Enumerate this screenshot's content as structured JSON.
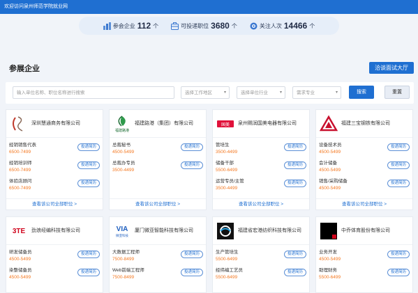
{
  "topbar": {
    "text": "欢迎访问泉州师范学院就业网"
  },
  "stats": [
    {
      "label": "参会企业",
      "value": "112",
      "unit": "个",
      "icon": "buildings-icon"
    },
    {
      "label": "可投递职位",
      "value": "3680",
      "unit": "个",
      "icon": "briefcase-icon"
    },
    {
      "label": "关注人次",
      "value": "14466",
      "unit": "个",
      "icon": "eye-icon"
    }
  ],
  "section": {
    "title": "参展企业",
    "hall_button": "洽谈面试大厅"
  },
  "filter": {
    "keyword_placeholder": "输入单位名称、职位名称进行搜索",
    "area": "选择工作地区",
    "industry": "选择单位行业",
    "major": "需求专业",
    "search": "搜索",
    "reset": "重置"
  },
  "apply_label": "投递简历",
  "more_label": "查看该公司全部职位 >",
  "companies": [
    {
      "name": "深圳慧通商务有限公司",
      "logo": "scroll-logo",
      "jobs": [
        {
          "title": "经销销售代表",
          "salary": "6500-7499"
        },
        {
          "title": "经销培训师",
          "salary": "6500-7499"
        },
        {
          "title": "体验店顾问",
          "salary": "6500-7499"
        }
      ]
    },
    {
      "name": "福建路港（集团）有限公司",
      "logo": "leaf-logo",
      "logo_text": "福建路港",
      "jobs": [
        {
          "title": "总裁秘书",
          "salary": "4500-5499"
        },
        {
          "title": "总裁办专员",
          "salary": "3500-4499"
        }
      ]
    },
    {
      "name": "泉州赐润国美电器有限公司",
      "logo": "gome-logo",
      "logo_text": "国美",
      "jobs": [
        {
          "title": "管培生",
          "salary": "3500-4499"
        },
        {
          "title": "储备干部",
          "salary": "5500-6499"
        },
        {
          "title": "运营专员/主管",
          "salary": "3500-4499"
        }
      ]
    },
    {
      "name": "福建三宝钢铁有限公司",
      "logo": "sanbao-logo",
      "jobs": [
        {
          "title": "设备技术员",
          "salary": "4500-5499"
        },
        {
          "title": "会计储备",
          "salary": "4500-5499"
        },
        {
          "title": "销售/采购储备",
          "salary": "4500-5499"
        }
      ]
    },
    {
      "name": "劲浪经编科技有限公司",
      "logo": "jinlang-logo",
      "logo_text": "3TE",
      "jobs": [
        {
          "title": "研发储备员",
          "salary": "4500-5499"
        },
        {
          "title": "染整储备员",
          "salary": "4500-5499"
        }
      ]
    },
    {
      "name": "厦门微亚智能科技有限公司",
      "logo": "via-logo",
      "logo_text": "VIA",
      "logo_sub": "微亚科技",
      "jobs": [
        {
          "title": "大数据工程师",
          "salary": "7500-8499"
        },
        {
          "title": "Web前端工程师",
          "salary": "7500-8499"
        }
      ]
    },
    {
      "name": "福建省宏港纺织科技有限公司",
      "logo": "honggang-logo",
      "jobs": [
        {
          "title": "生产管培生",
          "salary": "5500-6499"
        },
        {
          "title": "经纬编工艺员",
          "salary": "5500-6499"
        }
      ]
    },
    {
      "name": "中乔体育股份有限公司",
      "logo": "zhongqiao-logo",
      "jobs": [
        {
          "title": "业务开发",
          "salary": "4500-5499"
        },
        {
          "title": "助理财务",
          "salary": "5500-6499"
        }
      ]
    }
  ]
}
